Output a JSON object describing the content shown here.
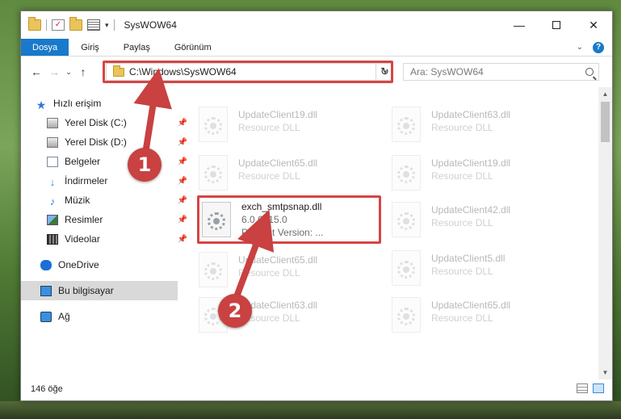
{
  "window": {
    "title": "SysWOW64",
    "controls": {
      "minimize": "—",
      "maximize": "",
      "close": "✕"
    }
  },
  "ribbon": {
    "tabs": [
      {
        "label": "Dosya",
        "active": true
      },
      {
        "label": "Giriş"
      },
      {
        "label": "Paylaş"
      },
      {
        "label": "Görünüm"
      }
    ]
  },
  "nav": {
    "back": "←",
    "forward": "→",
    "recent": "⌄",
    "up": "↑",
    "address": "C:\\Windows\\SysWOW64",
    "refresh": "↻",
    "search_placeholder": "Ara: SysWOW64"
  },
  "sidebar": {
    "quick_access": "Hızlı erişim",
    "items": [
      {
        "label": "Yerel Disk (C:)",
        "icon": "drive-icon",
        "pinned": true
      },
      {
        "label": "Yerel Disk (D:)",
        "icon": "drive-icon",
        "pinned": true
      },
      {
        "label": "Belgeler",
        "icon": "documents-icon",
        "pinned": true
      },
      {
        "label": "İndirmeler",
        "icon": "downloads-icon",
        "pinned": true
      },
      {
        "label": "Müzik",
        "icon": "music-icon",
        "pinned": true
      },
      {
        "label": "Resimler",
        "icon": "pictures-icon",
        "pinned": true
      },
      {
        "label": "Videolar",
        "icon": "videos-icon",
        "pinned": true
      }
    ],
    "onedrive": "OneDrive",
    "this_pc": "Bu bilgisayar",
    "network": "Ağ",
    "pin_glyph": "📌"
  },
  "files": {
    "left_column": [
      {
        "name": "UpdateClient19.dll",
        "desc": "Resource DLL",
        "faded": true
      },
      {
        "name": "UpdateClient65.dll",
        "desc": "Resource DLL",
        "faded": true
      },
      {
        "name": "exch_smtpsnap.dll",
        "desc": "6.0.6015.0",
        "desc2": "Product Version:     ...",
        "faded": false
      },
      {
        "name": "UpdateClient65.dll",
        "desc": "Resource DLL",
        "faded": true
      },
      {
        "name": "UpdateClient63.dll",
        "desc": "Resource DLL",
        "faded": true
      }
    ],
    "right_column": [
      {
        "name": "UpdateClient63.dll",
        "desc": "Resource DLL",
        "faded": true
      },
      {
        "name": "UpdateClient19.dll",
        "desc": "Resource DLL",
        "faded": true
      },
      {
        "name": "UpdateClient42.dll",
        "desc": "Resource DLL",
        "faded": true
      },
      {
        "name": "UpdateClient5.dll",
        "desc": "Resource DLL",
        "faded": true
      },
      {
        "name": "UpdateClient65.dll",
        "desc": "Resource DLL",
        "faded": true
      }
    ]
  },
  "status": {
    "item_count": "146 öğe"
  },
  "annotations": {
    "step1": "1",
    "step2": "2",
    "highlight_color": "#d64545",
    "badge_color": "#c94141"
  },
  "colors": {
    "accent": "#1979ca",
    "selection": "#d9d9d9"
  }
}
